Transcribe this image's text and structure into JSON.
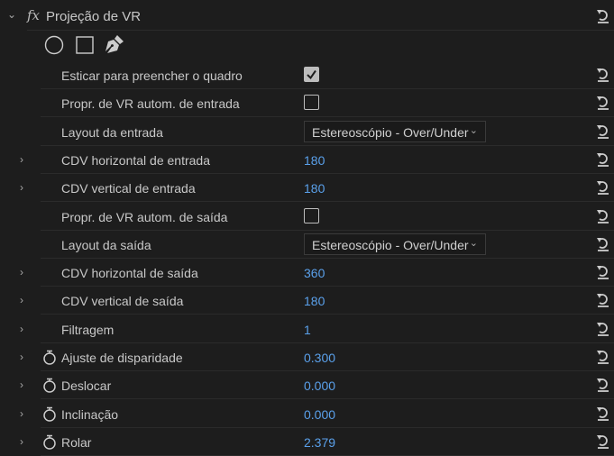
{
  "effect": {
    "title": "Projeção de VR",
    "fx_label": "fx"
  },
  "mask_tools": [
    "ellipse-mask",
    "rectangle-mask",
    "pen-mask"
  ],
  "properties": [
    {
      "label": "Esticar para preencher o quadro",
      "type": "checkbox",
      "checked": true,
      "expand": false,
      "stopwatch": false
    },
    {
      "label": "Propr. de VR autom. de entrada",
      "type": "checkbox",
      "checked": false,
      "expand": false,
      "stopwatch": false
    },
    {
      "label": "Layout da entrada",
      "type": "select",
      "value": "Estereoscópio - Over/Under",
      "expand": false,
      "stopwatch": false
    },
    {
      "label": "CDV horizontal de entrada",
      "type": "value",
      "value": "180",
      "expand": true,
      "stopwatch": false
    },
    {
      "label": "CDV vertical de entrada",
      "type": "value",
      "value": "180",
      "expand": true,
      "stopwatch": false
    },
    {
      "label": "Propr. de VR autom. de saída",
      "type": "checkbox",
      "checked": false,
      "expand": false,
      "stopwatch": false
    },
    {
      "label": "Layout da saída",
      "type": "select",
      "value": "Estereoscópio - Over/Under",
      "expand": false,
      "stopwatch": false
    },
    {
      "label": "CDV horizontal de saída",
      "type": "value",
      "value": "360",
      "expand": true,
      "stopwatch": false
    },
    {
      "label": "CDV vertical de saída",
      "type": "value",
      "value": "180",
      "expand": true,
      "stopwatch": false
    },
    {
      "label": "Filtragem",
      "type": "value",
      "value": "1",
      "expand": true,
      "stopwatch": false
    },
    {
      "label": "Ajuste de disparidade",
      "type": "value",
      "value": "0.300",
      "expand": true,
      "stopwatch": true
    },
    {
      "label": "Deslocar",
      "type": "value",
      "value": "0.000",
      "expand": true,
      "stopwatch": true
    },
    {
      "label": "Inclinação",
      "type": "value",
      "value": "0.000",
      "expand": true,
      "stopwatch": true
    },
    {
      "label": "Rolar",
      "type": "value",
      "value": "2.379",
      "expand": true,
      "stopwatch": true
    }
  ],
  "colors": {
    "value": "#5aa0ea",
    "background": "#1d1d1d"
  }
}
